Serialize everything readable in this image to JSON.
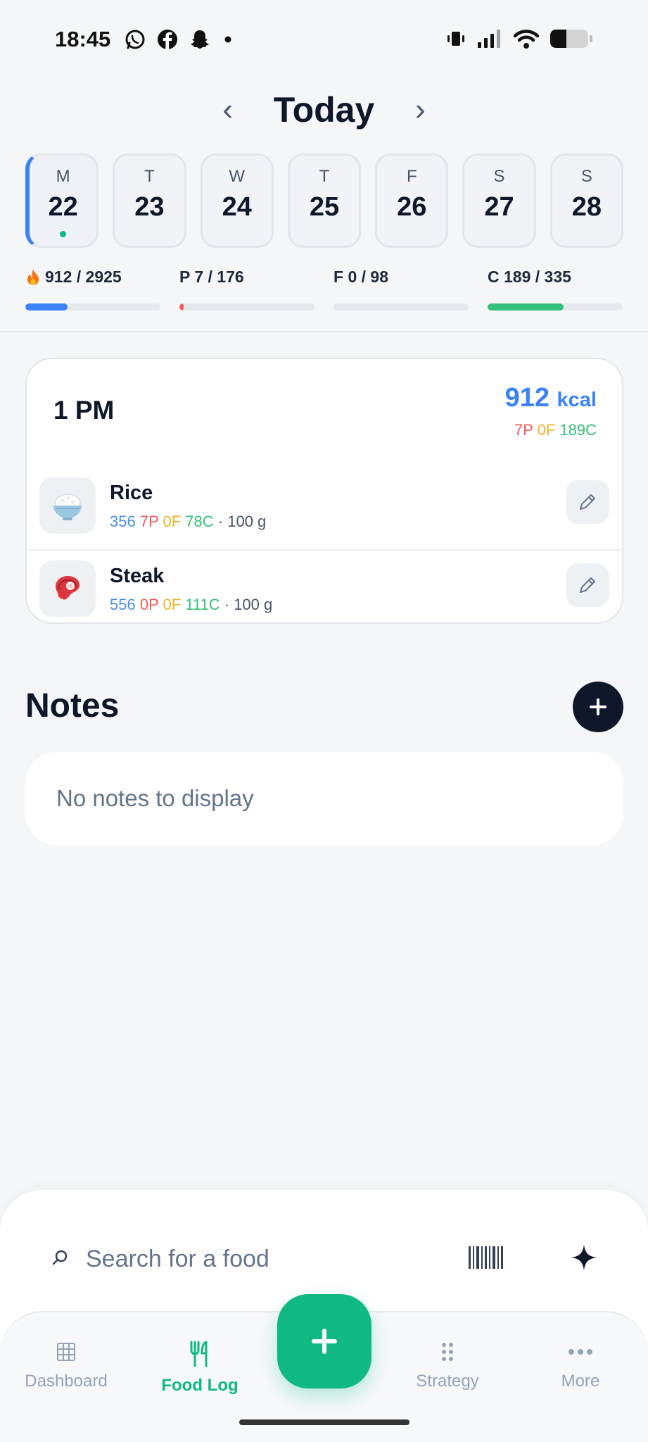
{
  "status_bar": {
    "time": "18:45",
    "app_icons": [
      "whatsapp-icon",
      "facebook-icon",
      "snapchat-icon",
      "dot-icon"
    ],
    "right_icons": [
      "vibrate-icon",
      "signal-icon",
      "wifi-icon",
      "battery-icon"
    ]
  },
  "date_nav": {
    "prev": "‹",
    "title": "Today",
    "next": "›"
  },
  "week": [
    {
      "letter": "M",
      "num": "22",
      "selected": true
    },
    {
      "letter": "T",
      "num": "23"
    },
    {
      "letter": "W",
      "num": "24"
    },
    {
      "letter": "T",
      "num": "25"
    },
    {
      "letter": "F",
      "num": "26"
    },
    {
      "letter": "S",
      "num": "27"
    },
    {
      "letter": "S",
      "num": "28"
    }
  ],
  "macros": {
    "calories": {
      "label": "912 / 2925",
      "progress": 0.31,
      "color": "#3b82f6"
    },
    "protein": {
      "label": "P 7 / 176",
      "progress": 0.04,
      "color": "#ef5b5b"
    },
    "fat": {
      "label": "F 0 / 98",
      "progress": 0,
      "color": "#f0b429"
    },
    "carbs": {
      "label": "C 189 / 335",
      "progress": 0.56,
      "color": "#34c07a"
    }
  },
  "meal": {
    "time": "1 PM",
    "kcal": "912",
    "kcal_unit": "kcal",
    "p": "7P",
    "f": "0F",
    "c": "189C",
    "foods": [
      {
        "name": "Rice",
        "kcal": "356",
        "p": "7P",
        "f": "0F",
        "c": "78C",
        "qty": "· 100 g",
        "icon": "rice-bowl-icon"
      },
      {
        "name": "Steak",
        "kcal": "556",
        "p": "0P",
        "f": "0F",
        "c": "111C",
        "qty": "· 100 g",
        "icon": "steak-icon"
      }
    ]
  },
  "notes": {
    "title": "Notes",
    "empty_text": "No notes to display"
  },
  "search": {
    "placeholder": "Search for a food"
  },
  "bottom_nav": {
    "items": [
      {
        "label": "Dashboard",
        "icon": "grid-icon"
      },
      {
        "label": "Food Log",
        "icon": "utensils-icon",
        "active": true
      },
      {
        "label": "Strategy",
        "icon": "dots-grid-icon"
      },
      {
        "label": "More",
        "icon": "more-icon"
      }
    ]
  },
  "colors": {
    "accent": "#10b981",
    "calorie_blue": "#3b82f6",
    "protein_red": "#ef5b5b",
    "fat_yellow": "#f0b429",
    "carb_green": "#34c07a"
  }
}
